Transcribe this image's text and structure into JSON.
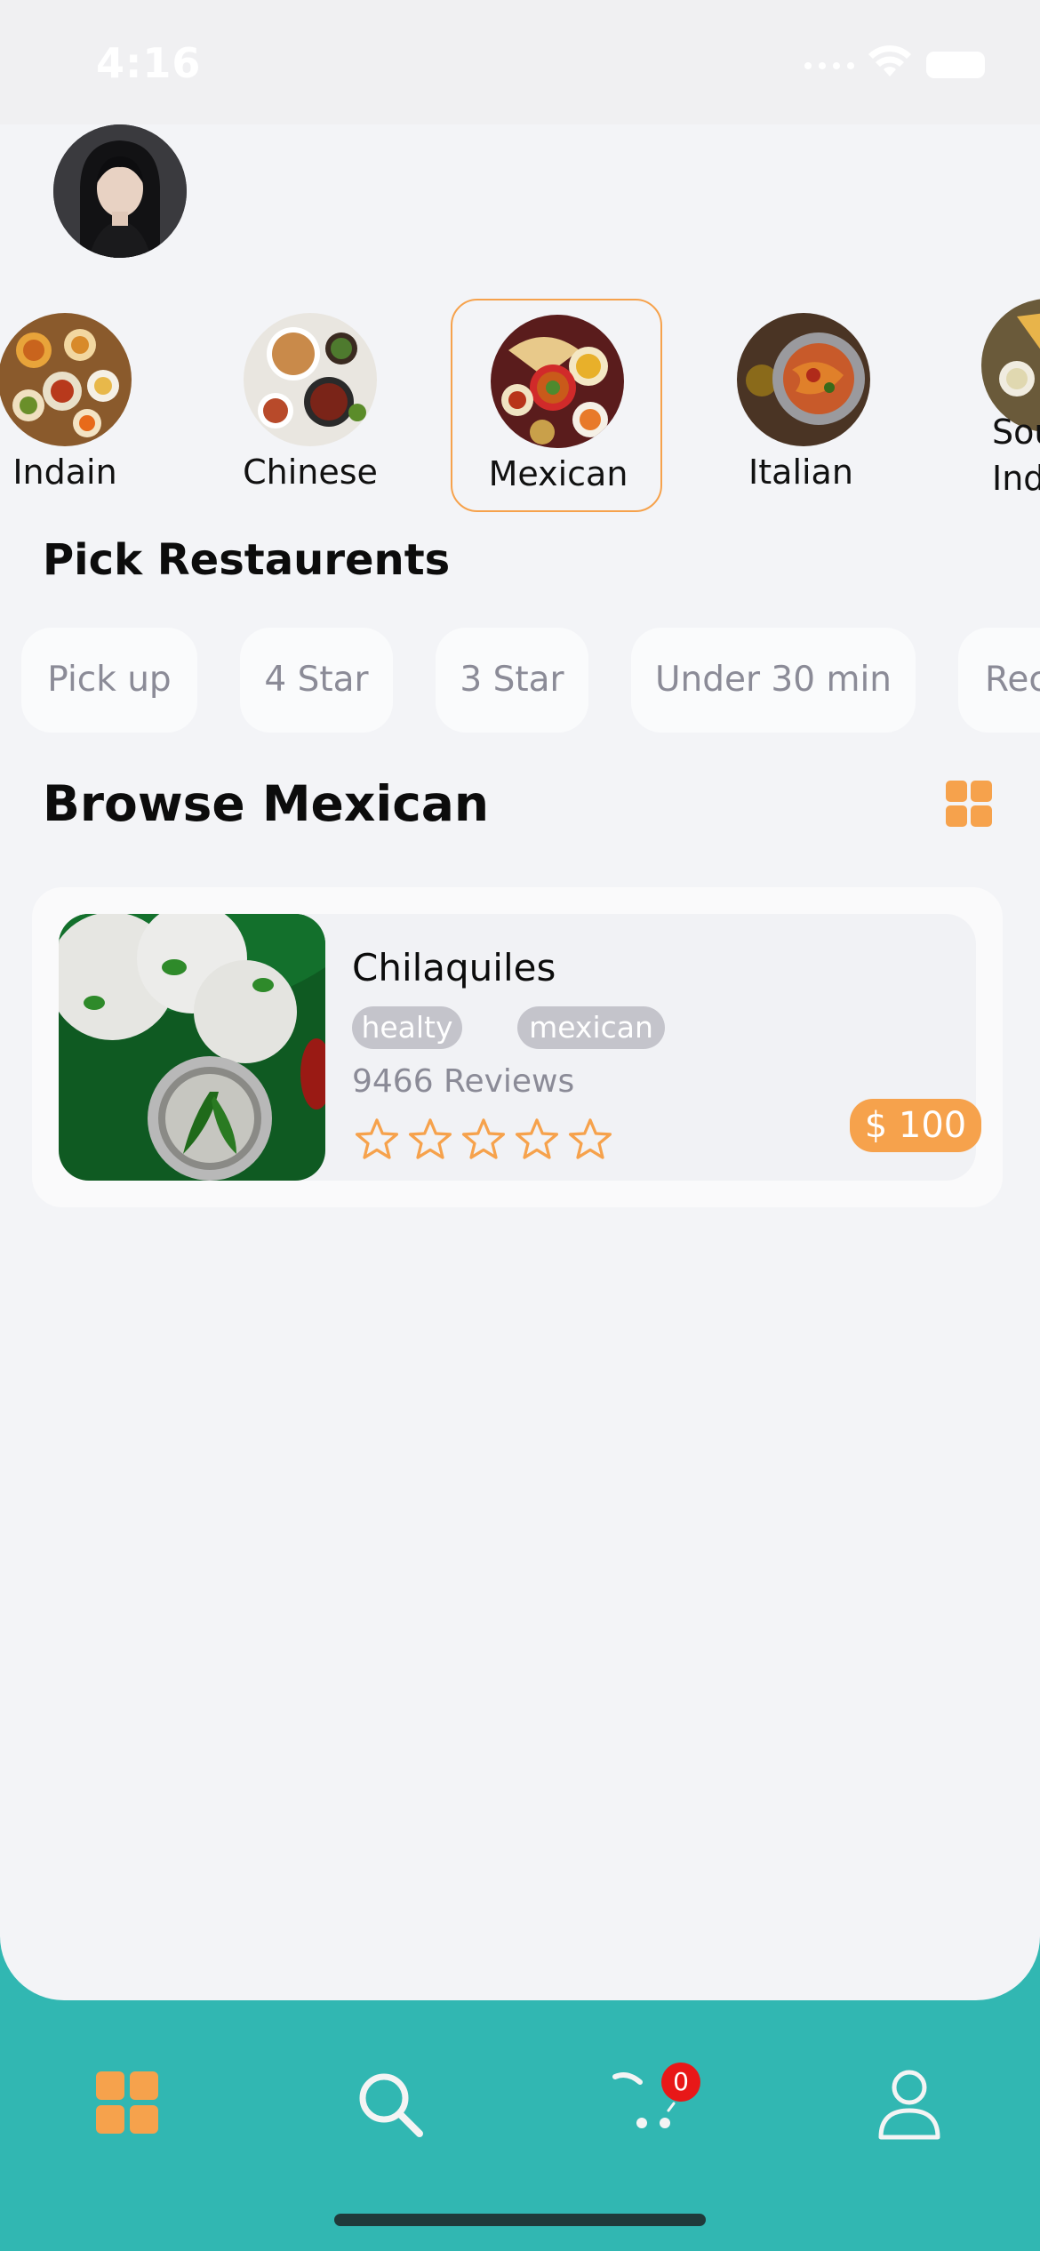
{
  "status_bar": {
    "time": "4:16"
  },
  "categories": [
    {
      "label": "Indain",
      "selected": false
    },
    {
      "label": "Chinese",
      "selected": false
    },
    {
      "label": "Mexican",
      "selected": true
    },
    {
      "label": "Italian",
      "selected": false
    },
    {
      "label": "South\nIndian",
      "selected": false
    }
  ],
  "pick_section": {
    "title": "Pick Restaurents"
  },
  "filters": [
    "Pick up",
    "4 Star",
    "3 Star",
    "Under 30 min",
    "Recommended"
  ],
  "browse_section": {
    "title": "Browse Mexican",
    "view_icon": "grid-icon"
  },
  "items": [
    {
      "name": "Chilaquiles",
      "tags": [
        "healty",
        "mexican"
      ],
      "reviews": "9466 Reviews",
      "rating_stars": 5,
      "rating_filled": 0,
      "price": "$ 100"
    }
  ],
  "bottom_nav": {
    "items": [
      "home-grid-icon",
      "search-icon",
      "cart-icon",
      "profile-icon"
    ],
    "active": "home-grid-icon",
    "cart_count": "0"
  },
  "colors": {
    "accent": "#f6a24c",
    "nav_background": "#31b7b2",
    "badge": "#e81818",
    "background": "#f3f4f7"
  }
}
